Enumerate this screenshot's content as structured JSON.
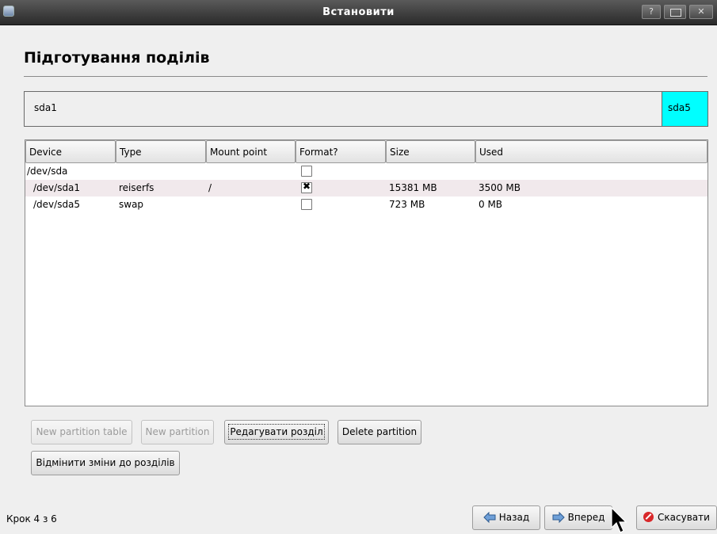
{
  "window": {
    "title": "Встановити",
    "help_label": "?"
  },
  "page": {
    "title": "Підготування поділів"
  },
  "partition_bar": {
    "segments": [
      {
        "label": "sda1"
      },
      {
        "label": "sda5",
        "color": "#00ffff"
      }
    ]
  },
  "table": {
    "columns": [
      "Device",
      "Type",
      "Mount point",
      "Format?",
      "Size",
      "Used"
    ],
    "rows": [
      {
        "device": "/dev/sda",
        "type": "",
        "mount": "",
        "format": false,
        "size": "",
        "used": ""
      },
      {
        "device": "/dev/sda1",
        "type": "reiserfs",
        "mount": "/",
        "format": true,
        "size": "15381 MB",
        "used": "3500 MB"
      },
      {
        "device": "/dev/sda5",
        "type": "swap",
        "mount": "",
        "format": false,
        "size": "723 MB",
        "used": "0 MB"
      }
    ]
  },
  "actions": {
    "new_partition_table": "New partition table",
    "new_partition": "New partition",
    "edit_partition": "Редагувати розділ",
    "delete_partition": "Delete partition",
    "undo_changes": "Відмінити зміни до розділів"
  },
  "footer": {
    "step": "Крок 4 з 6",
    "back": "Назад",
    "forward": "Вперед",
    "cancel": "Скасувати"
  },
  "colors": {
    "titlebar": "#3a3a3a",
    "selected_row": "#f1e9ec",
    "sda5_segment": "#00ffff",
    "cancel_icon": "#d8282a"
  }
}
